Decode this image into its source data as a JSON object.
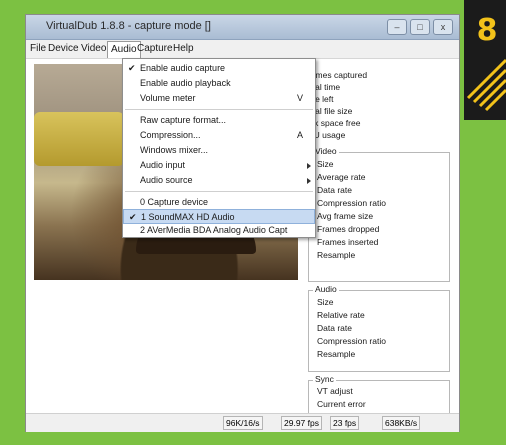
{
  "badge": {
    "number": "8"
  },
  "window": {
    "title": "VirtualDub 1.8.8 - capture mode []",
    "controls": {
      "minimize": "–",
      "maximize": "□",
      "close": "x"
    }
  },
  "menubar": [
    "File",
    "Device",
    "Video",
    "Audio",
    "Capture",
    "Help"
  ],
  "audio_menu": {
    "items": [
      {
        "label": "Enable audio capture",
        "checked": true,
        "shortcut": ""
      },
      {
        "label": "Enable audio playback",
        "checked": false,
        "shortcut": ""
      },
      {
        "label": "Volume meter",
        "checked": false,
        "shortcut": "V"
      },
      {
        "label": "Raw capture format...",
        "checked": false,
        "shortcut": ""
      },
      {
        "label": "Compression...",
        "checked": false,
        "shortcut": "A"
      },
      {
        "label": "Windows mixer...",
        "checked": false,
        "shortcut": ""
      },
      {
        "label": "Audio input",
        "checked": false,
        "submenu": true
      },
      {
        "label": "Audio source",
        "checked": false,
        "submenu": true
      },
      {
        "label": "0 Capture device",
        "checked": false,
        "shortcut": ""
      },
      {
        "label": "1 SoundMAX HD Audio",
        "checked": true,
        "shortcut": ""
      },
      {
        "label": "2 AVerMedia BDA Analog Audio Capt",
        "checked": false,
        "shortcut": ""
      }
    ]
  },
  "stats": {
    "top": [
      "rames captured",
      "otal time",
      "me left",
      "otal file size",
      "isk space free",
      "PU usage"
    ],
    "video": {
      "title": "Video",
      "items": [
        "Size",
        "Average rate",
        "Data rate",
        "Compression ratio",
        "Avg frame size",
        "Frames dropped",
        "Frames inserted",
        "Resample"
      ]
    },
    "audio": {
      "title": "Audio",
      "items": [
        "Size",
        "Relative rate",
        "Data rate",
        "Compression ratio",
        "Resample"
      ]
    },
    "sync": {
      "title": "Sync",
      "items": [
        "VT adjust",
        "Current error"
      ]
    }
  },
  "statusbar": [
    "96K/16/s",
    "29.97 fps",
    "23 fps",
    "638KB/s"
  ]
}
